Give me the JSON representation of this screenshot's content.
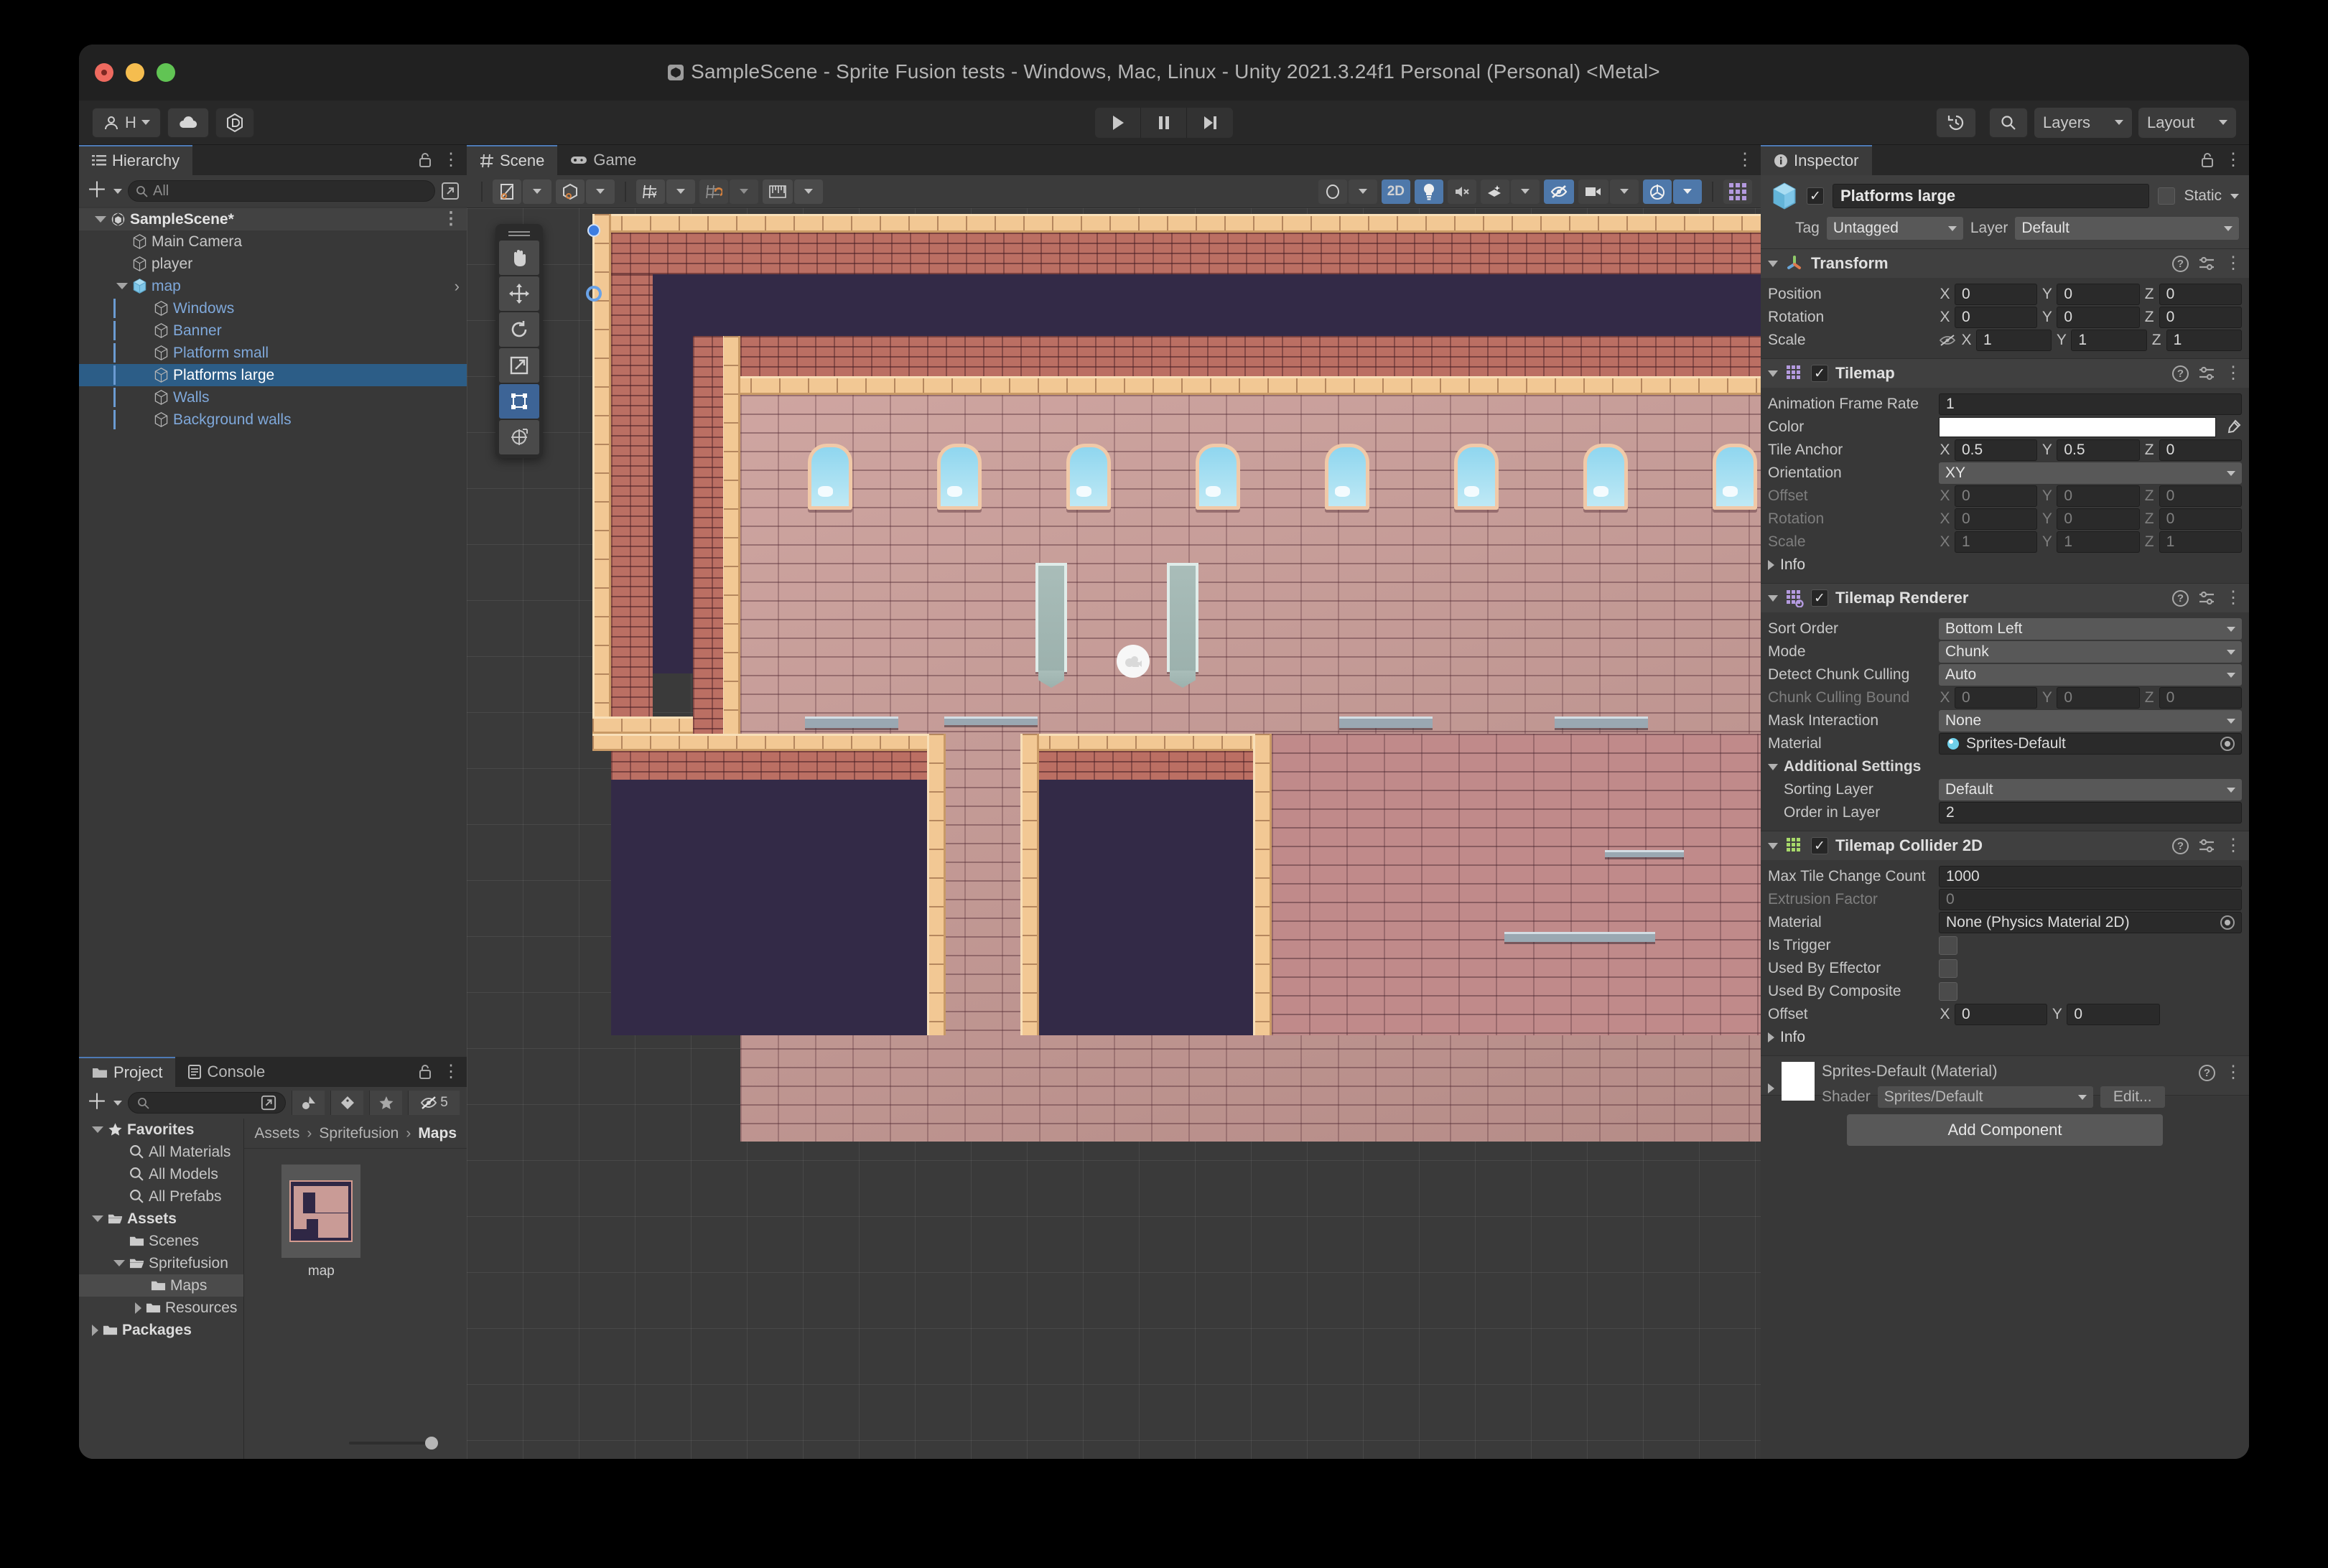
{
  "window": {
    "title": "SampleScene - Sprite Fusion tests - Windows, Mac, Linux - Unity 2021.3.24f1 Personal (Personal) <Metal>"
  },
  "toolbar": {
    "account_label": "H",
    "cloud_icon": "cloud-icon",
    "services_icon": "unity-services-icon",
    "play_icon": "play-icon",
    "pause_icon": "pause-icon",
    "step_icon": "step-icon",
    "history_icon": "undo-history-icon",
    "search_icon": "search-icon",
    "layers_label": "Layers",
    "layout_label": "Layout"
  },
  "hierarchy": {
    "tab_label": "Hierarchy",
    "tab_icon": "hierarchy-icon",
    "add_label": "+",
    "search_placeholder": "All",
    "items": [
      {
        "label": "SampleScene*",
        "depth": 0,
        "type": "scene",
        "expanded": true
      },
      {
        "label": "Main Camera",
        "depth": 1,
        "type": "object"
      },
      {
        "label": "player",
        "depth": 1,
        "type": "object"
      },
      {
        "label": "map",
        "depth": 1,
        "type": "prefab",
        "expanded": true
      },
      {
        "label": "Windows",
        "depth": 2,
        "type": "prefab-child"
      },
      {
        "label": "Banner",
        "depth": 2,
        "type": "prefab-child"
      },
      {
        "label": "Platform small",
        "depth": 2,
        "type": "prefab-child"
      },
      {
        "label": "Platforms large",
        "depth": 2,
        "type": "prefab-child",
        "selected": true
      },
      {
        "label": "Walls",
        "depth": 2,
        "type": "prefab-child"
      },
      {
        "label": "Background walls",
        "depth": 2,
        "type": "prefab-child"
      }
    ]
  },
  "scene": {
    "tabs": [
      {
        "label": "Scene",
        "icon": "scene-grid-icon",
        "active": true
      },
      {
        "label": "Game",
        "icon": "gamepad-icon",
        "active": false
      }
    ],
    "toolbar_left": [
      {
        "name": "draw-mode-dropdown",
        "icon": "shading-mode-icon"
      },
      {
        "name": "2d-3d-toggle-dropdown",
        "icon": "cube-icon"
      },
      {
        "name": "grid-axis-dropdown",
        "icon": "grid-y-icon"
      },
      {
        "name": "grid-snap-dropdown",
        "icon": "grid-snap-icon"
      },
      {
        "name": "snap-increment-dropdown",
        "icon": "ruler-icon"
      }
    ],
    "toolbar_right": [
      {
        "name": "shaded-mode",
        "label": "",
        "icon": "sphere-icon",
        "active": false
      },
      {
        "name": "2d-toggle",
        "label": "2D",
        "icon": "",
        "active": true
      },
      {
        "name": "lighting-toggle",
        "label": "",
        "icon": "light-bulb-icon",
        "active": true
      },
      {
        "name": "audio-toggle",
        "label": "",
        "icon": "mute-audio-icon",
        "active": false
      },
      {
        "name": "fx-dropdown",
        "label": "",
        "icon": "effects-icon",
        "active": false
      },
      {
        "name": "hidden-objects-toggle",
        "label": "",
        "icon": "eye-off-icon",
        "active": true
      },
      {
        "name": "camera-dropdown",
        "label": "",
        "icon": "camera-icon",
        "active": false
      },
      {
        "name": "gizmos-toggle",
        "label": "",
        "icon": "gizmos-icon",
        "active": true
      },
      {
        "name": "tile-palette",
        "label": "",
        "icon": "tile-grid-icon",
        "active": false
      }
    ],
    "tools": [
      {
        "name": "hand-tool",
        "icon": "hand-icon",
        "active": false
      },
      {
        "name": "move-tool",
        "icon": "move-arrows-icon",
        "active": false
      },
      {
        "name": "rotate-tool",
        "icon": "rotate-icon",
        "active": false
      },
      {
        "name": "scale-tool",
        "icon": "scale-icon",
        "active": false
      },
      {
        "name": "rect-transform-tool",
        "icon": "rect-transform-icon",
        "active": true
      },
      {
        "name": "transform-tool",
        "icon": "transform-icon",
        "active": false
      }
    ]
  },
  "project": {
    "tabs": [
      {
        "label": "Project",
        "icon": "folder-icon",
        "active": true
      },
      {
        "label": "Console",
        "icon": "console-icon",
        "active": false
      }
    ],
    "add_label": "+",
    "search_placeholder": "",
    "hidden_count": "5",
    "filters": [
      {
        "name": "filter-by-type",
        "icon": "asset-type-icon"
      },
      {
        "name": "filter-by-label",
        "icon": "label-tag-icon"
      },
      {
        "name": "filter-favorites",
        "icon": "star-icon"
      },
      {
        "name": "hidden-packages",
        "icon": "eye-off-icon"
      }
    ],
    "tree": [
      {
        "label": "Favorites",
        "depth": 0,
        "icon": "star-icon",
        "bold": true,
        "expanded": true
      },
      {
        "label": "All Materials",
        "depth": 1,
        "icon": "search-icon"
      },
      {
        "label": "All Models",
        "depth": 1,
        "icon": "search-icon"
      },
      {
        "label": "All Prefabs",
        "depth": 1,
        "icon": "search-icon"
      },
      {
        "label": "Assets",
        "depth": 0,
        "icon": "folder-open-icon",
        "bold": true,
        "expanded": true
      },
      {
        "label": "Scenes",
        "depth": 1,
        "icon": "folder-icon"
      },
      {
        "label": "Spritefusion",
        "depth": 1,
        "icon": "folder-open-icon",
        "expanded": true
      },
      {
        "label": "Maps",
        "depth": 2,
        "icon": "folder-icon",
        "selected": true
      },
      {
        "label": "Resources",
        "depth": 2,
        "icon": "folder-icon",
        "collapsed": true
      },
      {
        "label": "Packages",
        "depth": 0,
        "icon": "folder-icon",
        "bold": true,
        "collapsed": true
      }
    ],
    "breadcrumb": [
      "Assets",
      "Spritefusion",
      "Maps"
    ],
    "assets": [
      {
        "label": "map",
        "icon": "tilemap-thumbnail"
      }
    ]
  },
  "inspector": {
    "tab_label": "Inspector",
    "tab_icon": "info-icon",
    "object": {
      "enabled": true,
      "name": "Platforms large",
      "static_label": "Static",
      "static_checked": false,
      "tag_label": "Tag",
      "tag_value": "Untagged",
      "layer_label": "Layer",
      "layer_value": "Default"
    },
    "components": [
      {
        "name": "Transform",
        "icon": "transform-axis-icon",
        "has_checkbox": false,
        "expanded": true,
        "rows": [
          {
            "label": "Position",
            "type": "vec3",
            "x": "0",
            "y": "0",
            "z": "0"
          },
          {
            "label": "Rotation",
            "type": "vec3",
            "x": "0",
            "y": "0",
            "z": "0"
          },
          {
            "label": "Scale",
            "type": "vec3",
            "x": "1",
            "y": "1",
            "z": "1",
            "lock_icon": "constrain-proportions-off-icon"
          }
        ]
      },
      {
        "name": "Tilemap",
        "icon": "tilemap-icon",
        "has_checkbox": true,
        "checked": true,
        "expanded": true,
        "rows": [
          {
            "label": "Animation Frame Rate",
            "type": "text",
            "value": "1"
          },
          {
            "label": "Color",
            "type": "color",
            "value": "#FFFFFF",
            "eyedropper": "eyedropper-icon"
          },
          {
            "label": "Tile Anchor",
            "type": "vec3",
            "x": "0.5",
            "y": "0.5",
            "z": "0"
          },
          {
            "label": "Orientation",
            "type": "select",
            "value": "XY"
          },
          {
            "label": "Offset",
            "type": "vec3",
            "x": "0",
            "y": "0",
            "z": "0",
            "dim": true
          },
          {
            "label": "Rotation",
            "type": "vec3",
            "x": "0",
            "y": "0",
            "z": "0",
            "dim": true
          },
          {
            "label": "Scale",
            "type": "vec3",
            "x": "1",
            "y": "1",
            "z": "1",
            "dim": true
          },
          {
            "label": "Info",
            "type": "foldout",
            "expanded": false
          }
        ]
      },
      {
        "name": "Tilemap Renderer",
        "icon": "tilemap-renderer-icon",
        "has_checkbox": true,
        "checked": true,
        "expanded": true,
        "rows": [
          {
            "label": "Sort Order",
            "type": "select",
            "value": "Bottom Left"
          },
          {
            "label": "Mode",
            "type": "select",
            "value": "Chunk"
          },
          {
            "label": "Detect Chunk Culling",
            "type": "select",
            "value": "Auto"
          },
          {
            "label": "Chunk Culling Bound",
            "type": "vec3",
            "x": "0",
            "y": "0",
            "z": "0",
            "dim": true
          },
          {
            "label": "Mask Interaction",
            "type": "select",
            "value": "None"
          },
          {
            "label": "Material",
            "type": "object",
            "value": "Sprites-Default",
            "icon": "material-sphere-icon"
          },
          {
            "label": "Additional Settings",
            "type": "foldout",
            "expanded": true,
            "bold": true
          },
          {
            "label": "Sorting Layer",
            "type": "select",
            "value": "Default",
            "indent": true
          },
          {
            "label": "Order in Layer",
            "type": "text",
            "value": "2",
            "indent": true
          }
        ]
      },
      {
        "name": "Tilemap Collider 2D",
        "icon": "tilemap-collider-icon",
        "has_checkbox": true,
        "checked": true,
        "expanded": true,
        "rows": [
          {
            "label": "Max Tile Change Count",
            "type": "text",
            "value": "1000"
          },
          {
            "label": "Extrusion Factor",
            "type": "text",
            "value": "0",
            "dim": true
          },
          {
            "label": "Material",
            "type": "object",
            "value": "None (Physics Material 2D)"
          },
          {
            "label": "Is Trigger",
            "type": "checkbox",
            "checked": false
          },
          {
            "label": "Used By Effector",
            "type": "checkbox",
            "checked": false
          },
          {
            "label": "Used By Composite",
            "type": "checkbox",
            "checked": false
          },
          {
            "label": "Offset",
            "type": "vec2",
            "x": "0",
            "y": "0"
          },
          {
            "label": "Info",
            "type": "foldout",
            "expanded": false
          }
        ]
      }
    ],
    "material_asset": {
      "title": "Sprites-Default (Material)",
      "shader_label": "Shader",
      "shader_value": "Sprites/Default",
      "edit_label": "Edit..."
    },
    "add_component_label": "Add Component"
  },
  "statusbar": {
    "icons": [
      {
        "name": "debug-off-icon"
      },
      {
        "name": "cache-server-off-icon"
      },
      {
        "name": "auto-refresh-off-icon"
      },
      {
        "name": "ready-check-icon"
      }
    ]
  }
}
